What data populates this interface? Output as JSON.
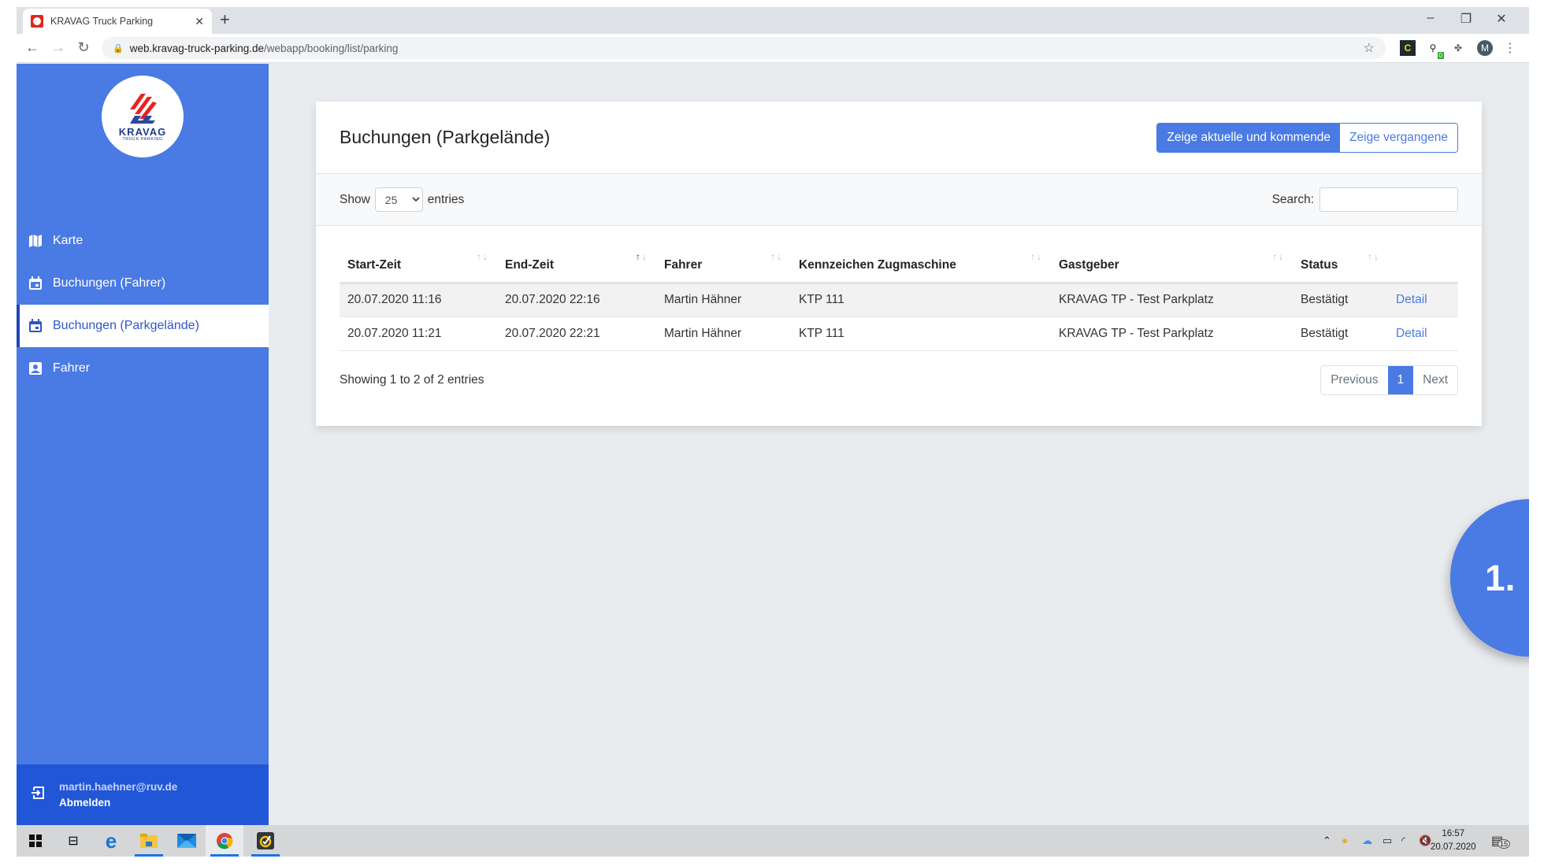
{
  "browser": {
    "tab_title": "KRAVAG Truck Parking",
    "url_host": "web.kravag-truck-parking.de",
    "url_path": "/webapp/booking/list/parking",
    "profile_initial": "M",
    "ext_badge": "0",
    "ext_c_label": "C"
  },
  "sidebar": {
    "logo_word": "KRAVAG",
    "logo_sub": "TRUCK PARKING",
    "items": [
      {
        "label": "Karte",
        "icon": "map-icon",
        "active": false
      },
      {
        "label": "Buchungen (Fahrer)",
        "icon": "calendar-icon",
        "active": false
      },
      {
        "label": "Buchungen (Parkgelände)",
        "icon": "calendar-icon",
        "active": true
      },
      {
        "label": "Fahrer",
        "icon": "contact-icon",
        "active": false
      }
    ],
    "user_email": "martin.haehner@ruv.de",
    "logout_label": "Abmelden"
  },
  "card": {
    "title": "Buchungen (Parkgelände)",
    "toggle": {
      "current_label": "Zeige aktuelle und kommende",
      "past_label": "Zeige vergangene"
    },
    "show_label": "Show",
    "entries_label": "entries",
    "page_size": "25",
    "search_label": "Search:",
    "search_value": "",
    "table": {
      "columns": [
        "Start-Zeit",
        "End-Zeit",
        "Fahrer",
        "Kennzeichen Zugmaschine",
        "Gastgeber",
        "Status",
        ""
      ],
      "sorted_column": "End-Zeit",
      "sort_direction": "ascending",
      "rows": [
        {
          "start": "20.07.2020 11:16",
          "end": "20.07.2020 22:16",
          "driver": "Martin Hähner",
          "plate": "KTP 111",
          "host": "KRAVAG TP - Test Parkplatz",
          "status": "Bestätigt",
          "action": "Detail"
        },
        {
          "start": "20.07.2020 11:21",
          "end": "20.07.2020 22:21",
          "driver": "Martin Hähner",
          "plate": "KTP 111",
          "host": "KRAVAG TP - Test Parkplatz",
          "status": "Bestätigt",
          "action": "Detail"
        }
      ]
    },
    "info": "Showing 1 to 2 of 2 entries",
    "pagination": {
      "previous": "Previous",
      "current": "1",
      "next": "Next"
    }
  },
  "step_bubble": "1.",
  "taskbar": {
    "time": "16:57",
    "date": "20.07.2020",
    "notification_count": "15"
  },
  "colors": {
    "primary": "#4a7ae3",
    "sidebar_footer": "#2157d6",
    "logo_red": "#e52421"
  }
}
